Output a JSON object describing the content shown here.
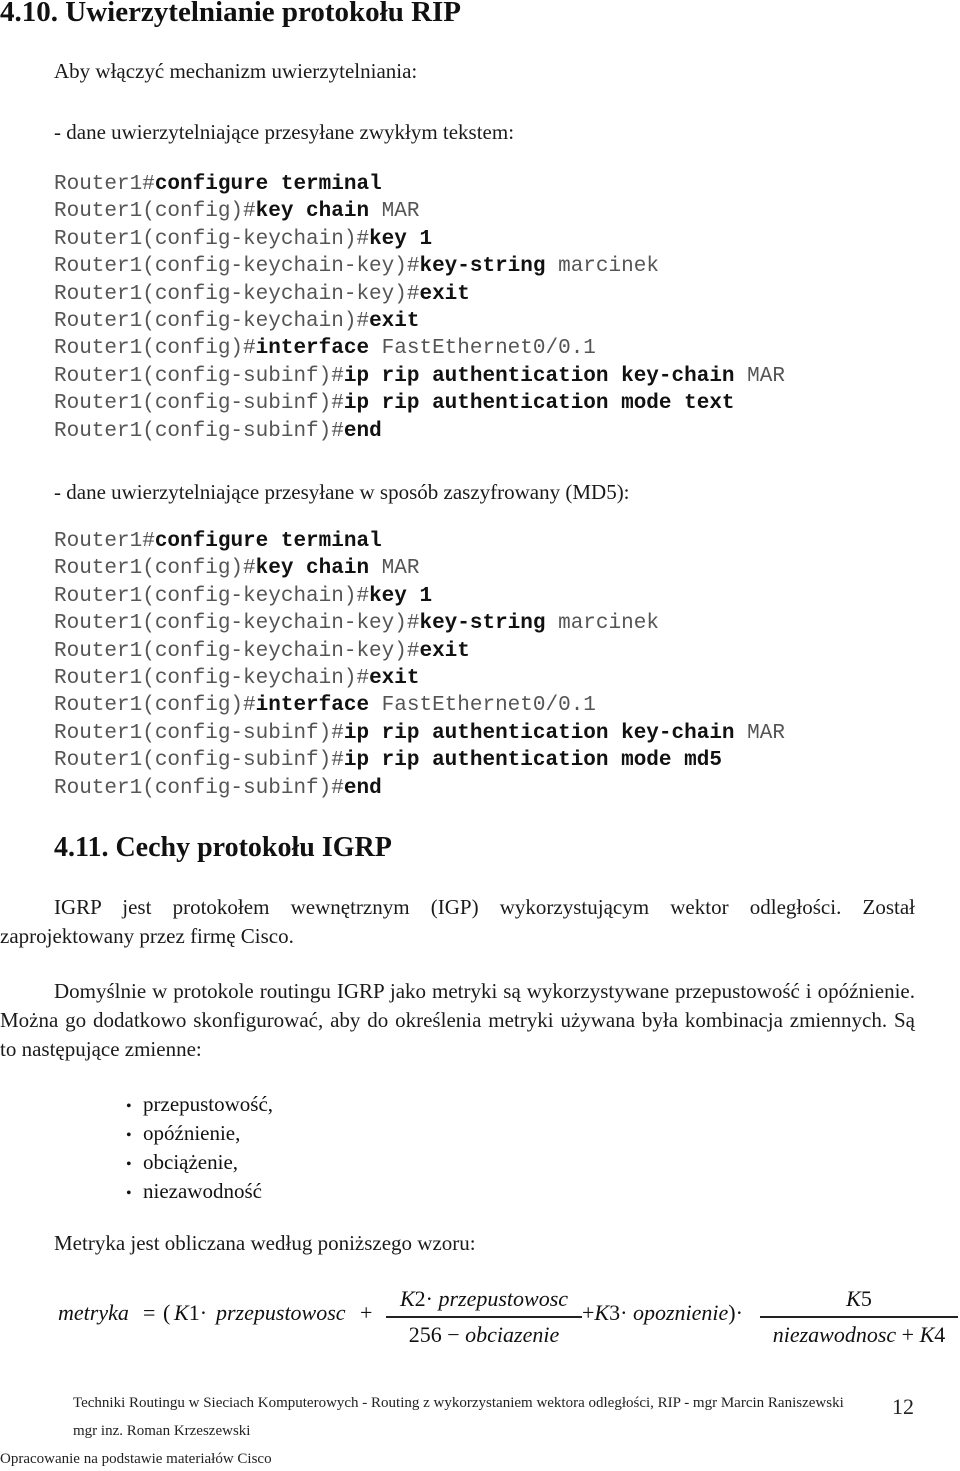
{
  "section_410": {
    "title": "4.10. Uwierzytelnianie protokołu RIP",
    "intro": "Aby włączyć mechanizm uwierzytelniania:",
    "plain_label": "- dane uwierzytelniające przesyłane zwykłym tekstem:",
    "plain_code": [
      {
        "prompt": "Router1#",
        "cmd": "configure terminal",
        "arg": ""
      },
      {
        "prompt": "Router1(config)#",
        "cmd": "key chain",
        "arg": " MAR"
      },
      {
        "prompt": "Router1(config-keychain)#",
        "cmd": "key 1",
        "arg": ""
      },
      {
        "prompt": "Router1(config-keychain-key)#",
        "cmd": "key-string",
        "arg": " marcinek"
      },
      {
        "prompt": "Router1(config-keychain-key)#",
        "cmd": "exit",
        "arg": ""
      },
      {
        "prompt": "Router1(config-keychain)#",
        "cmd": "exit",
        "arg": ""
      },
      {
        "prompt": "Router1(config)#",
        "cmd": "interface",
        "arg": " FastEthernet0/0.1"
      },
      {
        "prompt": "Router1(config-subinf)#",
        "cmd": "ip rip authentication key-chain",
        "arg": " MAR"
      },
      {
        "prompt": "Router1(config-subinf)#",
        "cmd": "ip rip authentication mode text",
        "arg": ""
      },
      {
        "prompt": "Router1(config-subinf)#",
        "cmd": "end",
        "arg": ""
      }
    ],
    "md5_label": "- dane uwierzytelniające przesyłane w sposób zaszyfrowany (MD5):",
    "md5_code": [
      {
        "prompt": "Router1#",
        "cmd": "configure terminal",
        "arg": ""
      },
      {
        "prompt": "Router1(config)#",
        "cmd": "key chain",
        "arg": " MAR"
      },
      {
        "prompt": "Router1(config-keychain)#",
        "cmd": "key 1",
        "arg": ""
      },
      {
        "prompt": "Router1(config-keychain-key)#",
        "cmd": "key-string",
        "arg": " marcinek"
      },
      {
        "prompt": "Router1(config-keychain-key)#",
        "cmd": "exit",
        "arg": ""
      },
      {
        "prompt": "Router1(config-keychain)#",
        "cmd": "exit",
        "arg": ""
      },
      {
        "prompt": "Router1(config)#",
        "cmd": "interface",
        "arg": " FastEthernet0/0.1"
      },
      {
        "prompt": "Router1(config-subinf)#",
        "cmd": "ip rip authentication key-chain",
        "arg": " MAR"
      },
      {
        "prompt": "Router1(config-subinf)#",
        "cmd": "ip rip authentication mode md5",
        "arg": ""
      },
      {
        "prompt": "Router1(config-subinf)#",
        "cmd": "end",
        "arg": ""
      }
    ]
  },
  "section_411": {
    "title": "4.11. Cechy protokołu IGRP",
    "para1": "IGRP jest protokołem wewnętrznym (IGP) wykorzystującym wektor odległości. Został zaprojektowany przez firmę Cisco.",
    "para2": "Domyślnie w protokole routingu IGRP jako metryki są wykorzystywane przepustowość i opóźnienie. Można go dodatkowo skonfigurować, aby do określenia metryki używana była kombinacja zmiennych. Są to następujące zmienne:",
    "bullet_symbol": "•",
    "variables": [
      "przepustowość,",
      "opóźnienie,",
      "obciążenie,",
      "niezawodność"
    ],
    "formula_intro": "Metryka jest obliczana według poniższego wzoru:",
    "formula": {
      "lhs": "metryka",
      "equals": "=",
      "open": "(",
      "k1": "K",
      "k1_idx": "1",
      "dot": "·",
      "term1": "przepustowosc",
      "plus": "+",
      "frac1_num_k": "K",
      "frac1_num_idx": "2",
      "frac1_num_var": "przepustowosc",
      "frac1_den_const": "256",
      "minus": "−",
      "frac1_den_var": "obciazenie",
      "k3": "K",
      "k3_idx": "3",
      "term3": "opoznienie",
      "close": ")",
      "frac2_num_k": "K",
      "frac2_num_idx": "5",
      "frac2_den_var": "niezawodnosc",
      "frac2_den_k": "K",
      "frac2_den_idx": "4"
    }
  },
  "footer": {
    "line1": "Techniki Routingu w Sieciach Komputerowych - Routing z wykorzystaniem wektora odległości, RIP - mgr Marcin Raniszewski",
    "line2": "mgr inz. Roman Krzeszewski",
    "line3": "Opracowanie na podstawie materiałów Cisco",
    "page_number": "12"
  }
}
